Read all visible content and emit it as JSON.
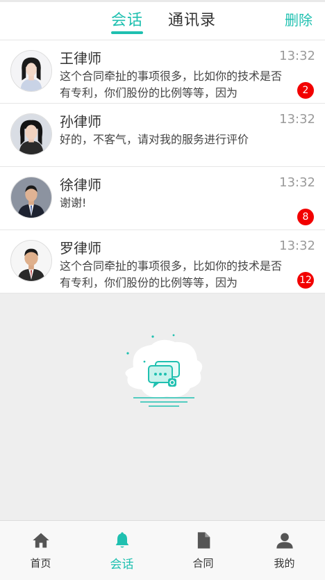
{
  "colors": {
    "accent": "#1fc0b0",
    "badge": "#f20000",
    "background": "#eeeeee"
  },
  "header": {
    "tabs": [
      {
        "label": "会话",
        "active": true
      },
      {
        "label": "通讯录",
        "active": false
      }
    ],
    "delete_label": "删除"
  },
  "conversations": [
    {
      "name": "王律师",
      "time": "13:32",
      "preview": "这个合同牵扯的事项很多，比如你的技术是否有专利，你们股份的比例等等，因为",
      "unread": "2",
      "avatar": "female-lawyer-avatar"
    },
    {
      "name": "孙律师",
      "time": "13:32",
      "preview": "好的，不客气，请对我的服务进行评价",
      "unread": "",
      "avatar": "female-lawyer-avatar"
    },
    {
      "name": "徐律师",
      "time": "13:32",
      "preview": "谢谢!",
      "unread": "8",
      "avatar": "male-lawyer-avatar"
    },
    {
      "name": "罗律师",
      "time": "13:32",
      "preview": "这个合同牵扯的事项很多，比如你的技术是否有专利，你们股份的比例等等，因为",
      "unread": "12",
      "avatar": "male-lawyer-avatar"
    }
  ],
  "empty_state": {
    "icon": "chat-bubbles-illustration"
  },
  "bottom_nav": [
    {
      "label": "首页",
      "icon": "home-icon",
      "active": false
    },
    {
      "label": "会话",
      "icon": "bell-icon",
      "active": true
    },
    {
      "label": "合同",
      "icon": "document-icon",
      "active": false
    },
    {
      "label": "我的",
      "icon": "user-icon",
      "active": false
    }
  ]
}
